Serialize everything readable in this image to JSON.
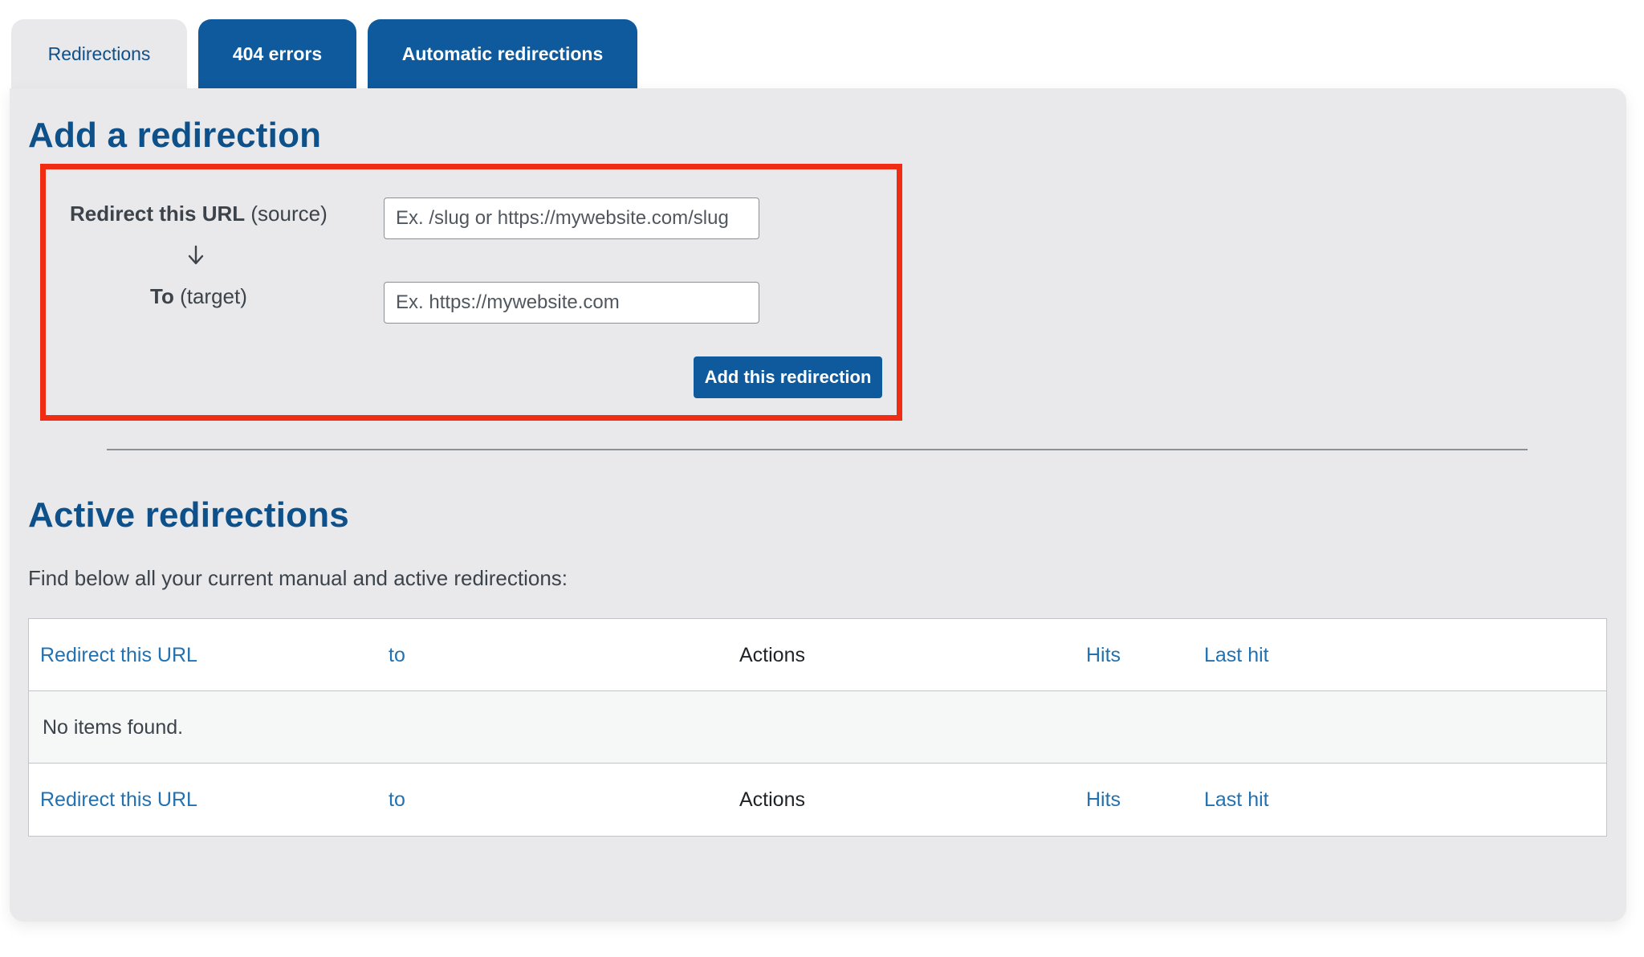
{
  "tabs": [
    {
      "label": "Redirections"
    },
    {
      "label": "404 errors"
    },
    {
      "label": "Automatic redirections"
    }
  ],
  "add_section": {
    "title": "Add a redirection",
    "source_label_bold": "Redirect this URL",
    "source_label_rest": " (source)",
    "target_label_bold": "To",
    "target_label_rest": " (target)",
    "source_placeholder": "Ex. /slug or https://mywebsite.com/slug",
    "target_placeholder": "Ex. https://mywebsite.com",
    "button_label": "Add this redirection"
  },
  "active_section": {
    "title": "Active redirections",
    "description": "Find below all your current manual and active redirections:",
    "columns": [
      "Redirect this URL",
      "to",
      "Actions",
      "Hits",
      "Last hit"
    ],
    "empty_message": "No items found."
  },
  "colors": {
    "accent": "#0e5a9c",
    "heading": "#0e5089",
    "highlight_border": "#f02d13",
    "link": "#2271b1",
    "panel_bg": "#e9e9eb"
  }
}
